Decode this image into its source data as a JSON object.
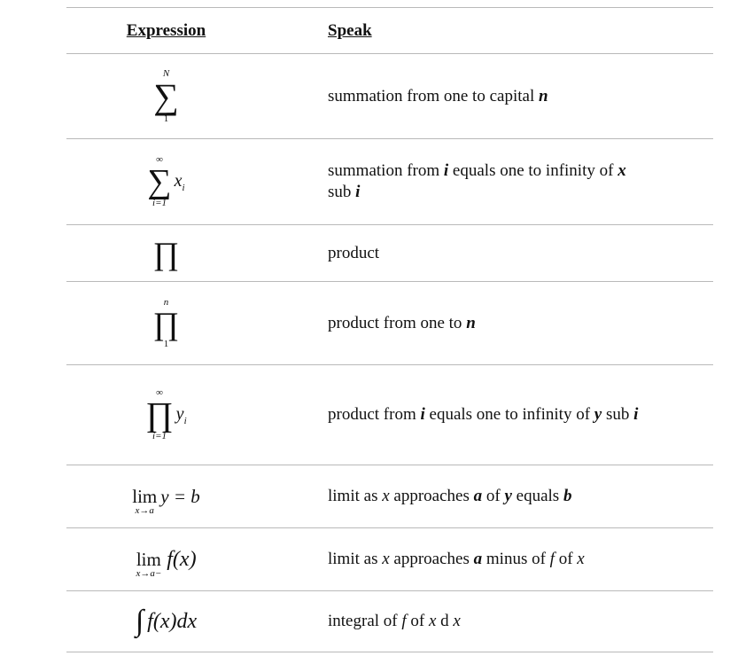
{
  "header": {
    "expression": "Expression",
    "speak": "Speak"
  },
  "rows": [
    {
      "speak": [
        "summation from one to capital ",
        "n"
      ],
      "expr": {
        "op": "∑",
        "upper": "N",
        "lower": "1"
      }
    },
    {
      "speak": [
        "summation from ",
        "i",
        " equals one to infinity of ",
        "x",
        " sub ",
        "i"
      ],
      "expr": {
        "op": "∑",
        "upper": "∞",
        "lower": "i=1",
        "body": "x",
        "body_sub": "i"
      }
    },
    {
      "speak": [
        "product"
      ],
      "expr": {
        "op": "∏"
      }
    },
    {
      "speak": [
        "product from one to ",
        "n"
      ],
      "expr": {
        "op": "∏",
        "upper": "n",
        "lower": "1"
      }
    },
    {
      "speak": [
        "product from ",
        "i",
        " equals one to infinity of ",
        "y",
        " sub ",
        "i"
      ],
      "expr": {
        "op": "∏",
        "upper": "∞",
        "lower": "i=1",
        "body": "y",
        "body_sub": "i"
      }
    },
    {
      "speak": [
        "limit as ",
        "x",
        " approaches ",
        "a",
        " of ",
        "y",
        " equals ",
        "b"
      ],
      "expr": {
        "lim": "lim",
        "under": "x→a",
        "tail": "y = b"
      }
    },
    {
      "speak": [
        "limit as ",
        "x",
        " approaches ",
        "a",
        " minus of ",
        "f",
        " of ",
        "x"
      ],
      "expr": {
        "lim": "lim",
        "under": "x→a−",
        "tail": "f(x)"
      }
    },
    {
      "speak": [
        "integral of ",
        "f",
        " of ",
        "x",
        " d ",
        "x"
      ],
      "expr": {
        "int": "∫",
        "tail": "f(x)dx"
      }
    }
  ]
}
